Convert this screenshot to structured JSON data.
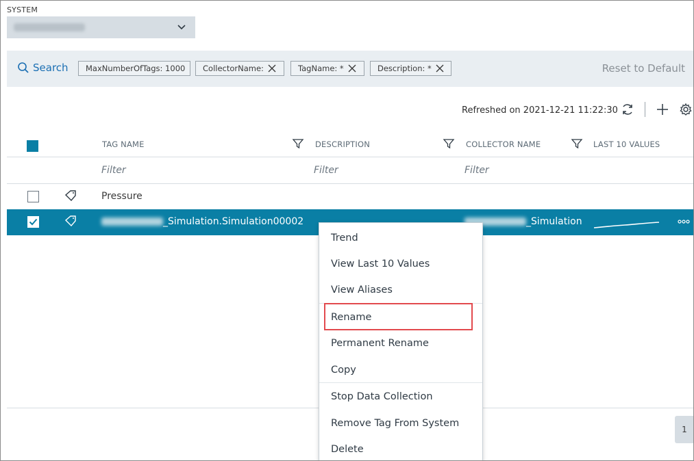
{
  "system": {
    "label": "SYSTEM",
    "selected_value": ""
  },
  "search": {
    "button_label": "Search",
    "chips": [
      {
        "label": "MaxNumberOfTags: 1000",
        "removable": false
      },
      {
        "label": "CollectorName:",
        "removable": true
      },
      {
        "label": "TagName: *",
        "removable": true
      },
      {
        "label": "Description: *",
        "removable": true
      }
    ],
    "reset_label": "Reset to Default"
  },
  "toolbar": {
    "refreshed_text": "Refreshed on 2021-12-21 11:22:30",
    "icons": [
      "refresh-icon",
      "add-icon",
      "gear-icon"
    ]
  },
  "table": {
    "columns": [
      "TAG NAME",
      "DESCRIPTION",
      "COLLECTOR NAME",
      "LAST 10 VALUES"
    ],
    "filter_placeholder": "Filter",
    "rows": [
      {
        "tag_name": "Pressure",
        "description": "",
        "collector_name": "",
        "selected": false
      },
      {
        "tag_name": "_Simulation.Simulation00002",
        "description": "",
        "collector_name": "_Simulation",
        "selected": true
      }
    ]
  },
  "context_menu": {
    "items": [
      "Trend",
      "View Last 10 Values",
      "View Aliases",
      "Rename",
      "Permanent Rename",
      "Copy",
      "Stop Data Collection",
      "Remove Tag From System",
      "Delete"
    ],
    "highlighted": "Rename"
  },
  "pagination": {
    "current_page": "1"
  },
  "colors": {
    "accent": "#0a7fa5",
    "link": "#1b6fb3",
    "highlight_border": "#e2494d"
  }
}
